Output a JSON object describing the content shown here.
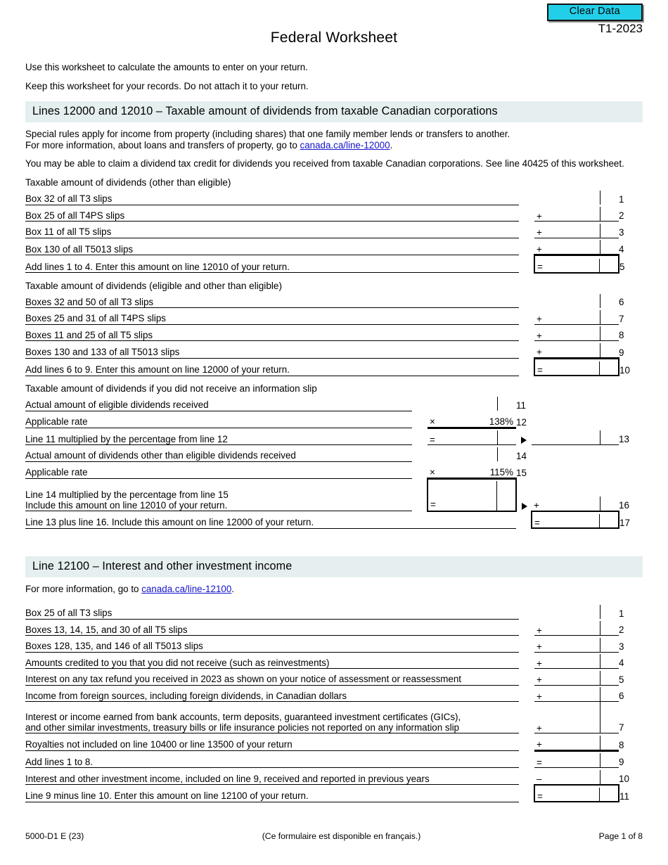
{
  "header": {
    "clear_data_label": "Clear Data",
    "form_year": "T1-2023",
    "title": "Federal Worksheet",
    "intro_line1": "Use this worksheet to calculate the amounts to enter on your return.",
    "intro_line2": "Keep this worksheet for your records. Do not attach it to your return."
  },
  "colors": {
    "clear_data_bg": "#22CFE8",
    "section_band_bg": "#E6EFEF",
    "link": "#1414CC"
  },
  "section1": {
    "band_title": "Lines 12000 and 12010 – Taxable amount of dividends from taxable Canadian corporations",
    "note1_a": "Special rules apply for income from property (including shares) that one family member lends or transfers to another.",
    "note1_b": "For more information, about loans and transfers of property, go to ",
    "note1_link": "canada.ca/line-12000",
    "note1_end": ".",
    "note2": "You may be able to claim a dividend tax credit for dividends you received from taxable Canadian corporations. See line 40425 of this worksheet.",
    "group1": {
      "heading": "Taxable amount of dividends (other than eligible)",
      "rows": [
        {
          "label": "Box 32 of all T3 slips",
          "op": "",
          "value": "",
          "num": "1"
        },
        {
          "label": "Box 25 of all T4PS slips",
          "op": "+",
          "value": "",
          "num": "2"
        },
        {
          "label": "Box 11 of all T5 slips",
          "op": "+",
          "value": "",
          "num": "3"
        },
        {
          "label": "Box 130 of all T5013 slips",
          "op": "+",
          "value": "",
          "num": "4"
        },
        {
          "label": "Add lines 1 to 4. Enter this amount on line 12010 of your return.",
          "op": "=",
          "value": "",
          "num": "5"
        }
      ]
    },
    "group2": {
      "heading": "Taxable amount of dividends (eligible and other than eligible)",
      "rows": [
        {
          "label": "Boxes 32 and 50 of all T3 slips",
          "op": "",
          "value": "",
          "num": "6"
        },
        {
          "label": "Boxes 25 and 31 of all T4PS slips",
          "op": "+",
          "value": "",
          "num": "7"
        },
        {
          "label": "Boxes 11 and 25 of all T5 slips",
          "op": "+",
          "value": "",
          "num": "8"
        },
        {
          "label": "Boxes 130 and 133 of all T5013 slips",
          "op": "+",
          "value": "",
          "num": "9"
        },
        {
          "label": "Add lines 6 to 9. Enter this amount on line 12000 of your return.",
          "op": "=",
          "value": "",
          "num": "10"
        }
      ]
    },
    "group3": {
      "heading": "Taxable amount of dividends if you did not receive an information slip",
      "row11": {
        "label": "Actual amount of eligible dividends received",
        "op": "",
        "value": "",
        "num": "11"
      },
      "row12": {
        "label": "Applicable rate",
        "op": "×",
        "value": "138%",
        "num": "12"
      },
      "row13": {
        "label": "Line 11 multiplied by the percentage from line 12",
        "op": "=",
        "value": "",
        "num": "13"
      },
      "row14": {
        "label": "Actual amount of dividends other than eligible dividends received",
        "op": "",
        "value": "",
        "num": "14"
      },
      "row15": {
        "label": "Applicable rate",
        "op": "×",
        "value": "115%",
        "num": "15"
      },
      "row16": {
        "label_a": "Line 14 multiplied by the percentage from line 15",
        "label_b": "Include this amount on line 12010 of your return.",
        "op": "=",
        "op_right": "+",
        "value": "",
        "num": "16"
      },
      "row17": {
        "label": "Line 13 plus line 16. Include this amount on line 12000 of your return.",
        "op": "=",
        "value": "",
        "num": "17"
      }
    }
  },
  "section2": {
    "band_title": "Line 12100 – Interest and other investment income",
    "note_a": "For more information, go to ",
    "note_link": "canada.ca/line-12100",
    "note_end": ".",
    "rows": [
      {
        "label": "Box 25 of all T3 slips",
        "op": "",
        "value": "",
        "num": "1"
      },
      {
        "label": "Boxes 13, 14, 15, and 30 of all T5 slips",
        "op": "+",
        "value": "",
        "num": "2"
      },
      {
        "label": "Boxes 128, 135, and 146 of all T5013 slips",
        "op": "+",
        "value": "",
        "num": "3"
      },
      {
        "label": "Amounts credited to you that you did not receive (such as reinvestments)",
        "op": "+",
        "value": "",
        "num": "4"
      },
      {
        "label": "Interest on any tax refund you received in 2023 as shown on your notice of assessment or reassessment",
        "op": "+",
        "value": "",
        "num": "5"
      },
      {
        "label": "Income from foreign sources, including foreign dividends, in Canadian dollars",
        "op": "+",
        "value": "",
        "num": "6"
      }
    ],
    "row7": {
      "label_a": "Interest or income earned from bank accounts, term deposits, guaranteed investment certificates (GICs),",
      "label_b": "and other similar investments, treasury bills or life insurance policies not reported on any information slip",
      "op": "+",
      "value": "",
      "num": "7"
    },
    "rows_tail": [
      {
        "label": "Royalties not included on line 10400 or line 13500 of your return",
        "op": "+",
        "value": "",
        "num": "8"
      },
      {
        "label": "Add lines 1 to 8.",
        "op": "=",
        "value": "",
        "num": "9"
      },
      {
        "label": "Interest and other investment income, included on line 9, received and reported in previous years",
        "op": "–",
        "value": "",
        "num": "10"
      },
      {
        "label": "Line 9 minus line 10. Enter this amount on line 12100 of your return.",
        "op": "=",
        "value": "",
        "num": "11"
      }
    ]
  },
  "footer": {
    "form_id": "5000-D1 E (23)",
    "french_note": "(Ce formulaire est disponible en français.)",
    "page_label": "Page 1 of 8"
  }
}
